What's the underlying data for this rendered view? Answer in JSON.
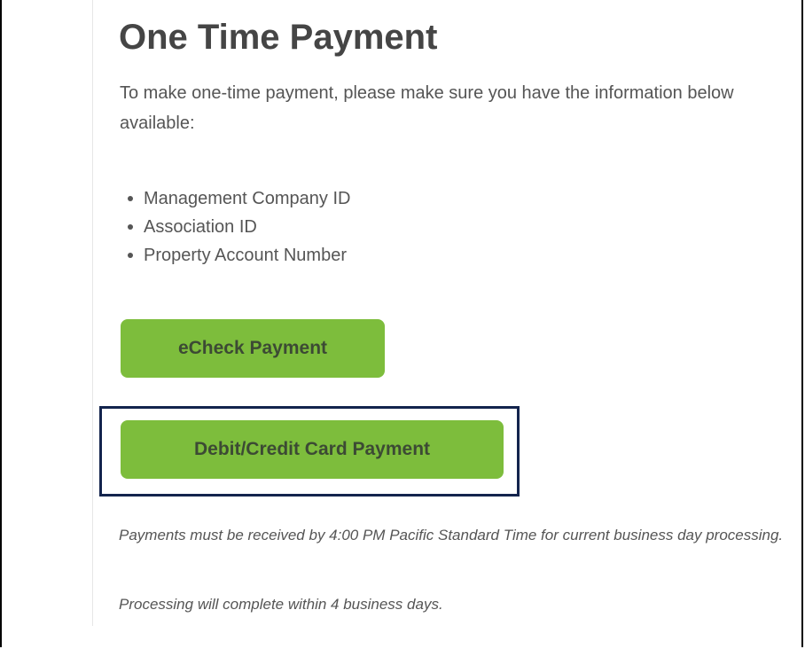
{
  "page": {
    "title": "One Time Payment",
    "intro": "To make one-time payment, please make sure you have the information below available:",
    "requirements": [
      "Management Company ID",
      "Association ID",
      "Property Account Number"
    ]
  },
  "buttons": {
    "echeck_label": "eCheck Payment",
    "card_label": "Debit/Credit Card Payment"
  },
  "notes": {
    "deadline": "Payments must be received by 4:00 PM Pacific Standard Time for current business day processing.",
    "processing": "Processing will complete within 4 business days."
  },
  "colors": {
    "button_bg": "#7dbd3c",
    "button_text": "#3c4a34",
    "highlight_border": "#13244d",
    "title_text": "#454545",
    "body_text": "#555555"
  }
}
